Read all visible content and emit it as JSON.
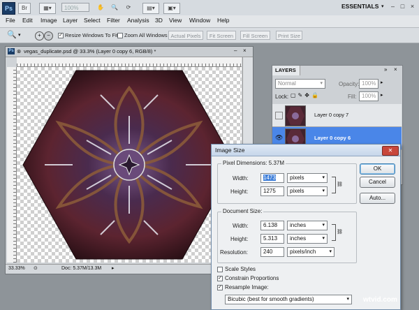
{
  "app": {
    "logo": "Ps",
    "zoom_placeholder": "100%",
    "workspace": "ESSENTIALS",
    "window_controls": [
      "–",
      "□",
      "×"
    ]
  },
  "menu": [
    "File",
    "Edit",
    "Image",
    "Layer",
    "Select",
    "Filter",
    "Analysis",
    "3D",
    "View",
    "Window",
    "Help"
  ],
  "options": {
    "resize_windows": "Resize Windows To Fit",
    "zoom_all": "Zoom All Windows",
    "actual_pixels": "Actual Pixels",
    "fit_screen": "Fit Screen",
    "fill_screen": "Fill Screen",
    "print_size": "Print Size"
  },
  "document": {
    "title": "vegas_duplicate.psd @ 33.3% (Layer 0 copy 6, RGB/8) *",
    "zoom": "33.33%",
    "doc_info": "Doc: 5.37M/13.3M"
  },
  "layers_panel": {
    "tab": "LAYERS",
    "blend_mode": "Normal",
    "opacity_label": "Opacity:",
    "opacity_value": "100%",
    "lock_label": "Lock:",
    "fill_label": "Fill:",
    "fill_value": "100%",
    "layers": [
      {
        "name": "Layer 0 copy 7",
        "selected": false
      },
      {
        "name": "Layer 0 copy 6",
        "selected": true
      }
    ]
  },
  "image_size": {
    "title": "Image Size",
    "pixel_dimensions": "Pixel Dimensions: 5.37M",
    "width_label": "Width:",
    "width_value": "1473",
    "width_unit": "pixels",
    "height_label": "Height:",
    "height_value": "1275",
    "height_unit": "pixels",
    "document_size": "Document Size:",
    "doc_width_label": "Width:",
    "doc_width_value": "6.138",
    "doc_width_unit": "inches",
    "doc_height_label": "Height:",
    "doc_height_value": "5.313",
    "doc_height_unit": "inches",
    "resolution_label": "Resolution:",
    "resolution_value": "240",
    "resolution_unit": "pixels/inch",
    "scale_styles": "Scale Styles",
    "constrain_proportions": "Constrain Proportions",
    "resample_image": "Resample Image:",
    "resample_method": "Bicubic (best for smooth gradients)",
    "ok": "OK",
    "cancel": "Cancel",
    "auto": "Auto..."
  },
  "watermark": "wtvid.com",
  "colors": {
    "selection": "#4a86e8",
    "image_dark": "#3a1a24",
    "image_mid": "#6b2f3c",
    "image_purple": "#5a3a6a"
  }
}
